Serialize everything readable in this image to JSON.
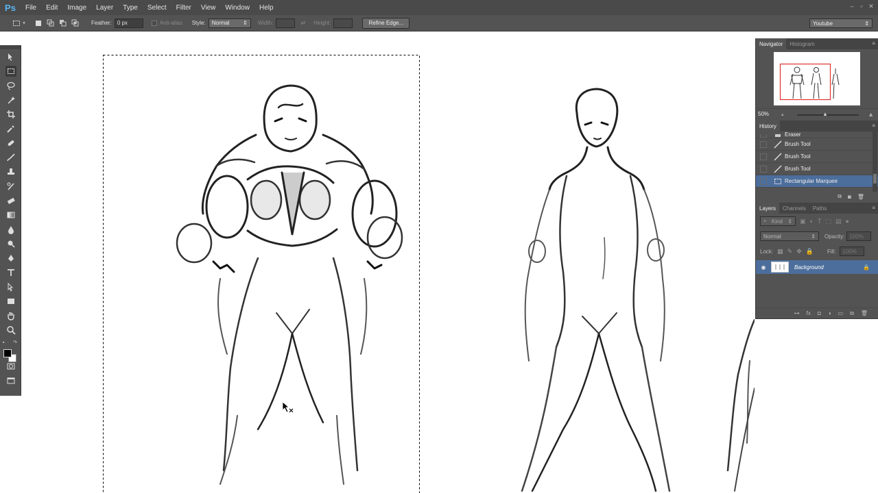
{
  "app": {
    "logo": "Ps"
  },
  "menu": [
    "File",
    "Edit",
    "Image",
    "Layer",
    "Type",
    "Select",
    "Filter",
    "View",
    "Window",
    "Help"
  ],
  "options": {
    "feather_label": "Feather:",
    "feather_value": "0 px",
    "antialias_label": "Anti-alias",
    "style_label": "Style:",
    "style_value": "Normal",
    "width_label": "Width:",
    "height_label": "Height:",
    "refine_edge": "Refine Edge...",
    "workspace": "Youtube"
  },
  "navigator": {
    "tabs": [
      "Navigator",
      "Histogram"
    ],
    "zoom": "50%",
    "view_box_color": "#e03030"
  },
  "history": {
    "title": "History",
    "items": [
      {
        "label": "Eraser",
        "icon": "eraser-icon"
      },
      {
        "label": "Brush Tool",
        "icon": "brush-icon"
      },
      {
        "label": "Brush Tool",
        "icon": "brush-icon"
      },
      {
        "label": "Brush Tool",
        "icon": "brush-icon"
      },
      {
        "label": "Rectangular Marquee",
        "icon": "marquee-icon",
        "selected": true
      }
    ]
  },
  "layers": {
    "tabs": [
      "Layers",
      "Channels",
      "Paths"
    ],
    "kind_label": "Kind",
    "blend_mode": "Normal",
    "opacity_label": "Opacity:",
    "opacity_value": "100%",
    "lock_label": "Lock:",
    "fill_label": "Fill:",
    "fill_value": "100%",
    "items": [
      {
        "name": "Background",
        "locked": true,
        "visible": true
      }
    ]
  },
  "colors": {
    "selection_highlight": "#4c6e9c",
    "panel_bg": "#535353",
    "menubar_bg": "#4a4a4a",
    "ps_logo": "#5ab4f0"
  }
}
